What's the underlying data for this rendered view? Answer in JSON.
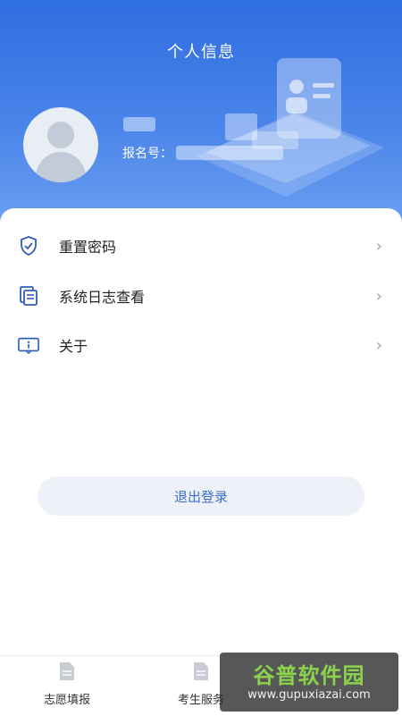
{
  "header": {
    "title": "个人信息",
    "reg_label": "报名号："
  },
  "menu": {
    "items": [
      {
        "label": "重置密码",
        "icon": "shield-check-icon"
      },
      {
        "label": "系统日志查看",
        "icon": "document-list-icon"
      },
      {
        "label": "关于",
        "icon": "info-icon"
      }
    ],
    "chevron": "›"
  },
  "logout_label": "退出登录",
  "tabbar": {
    "tabs": [
      {
        "label": "志愿填报"
      },
      {
        "label": "考生服务"
      }
    ]
  },
  "watermark": {
    "line1": "谷普软件园",
    "line2": "www.gupuxiazai.com"
  },
  "colors": {
    "header_top": "#2f6ee0",
    "accent": "#3d6fc9"
  }
}
